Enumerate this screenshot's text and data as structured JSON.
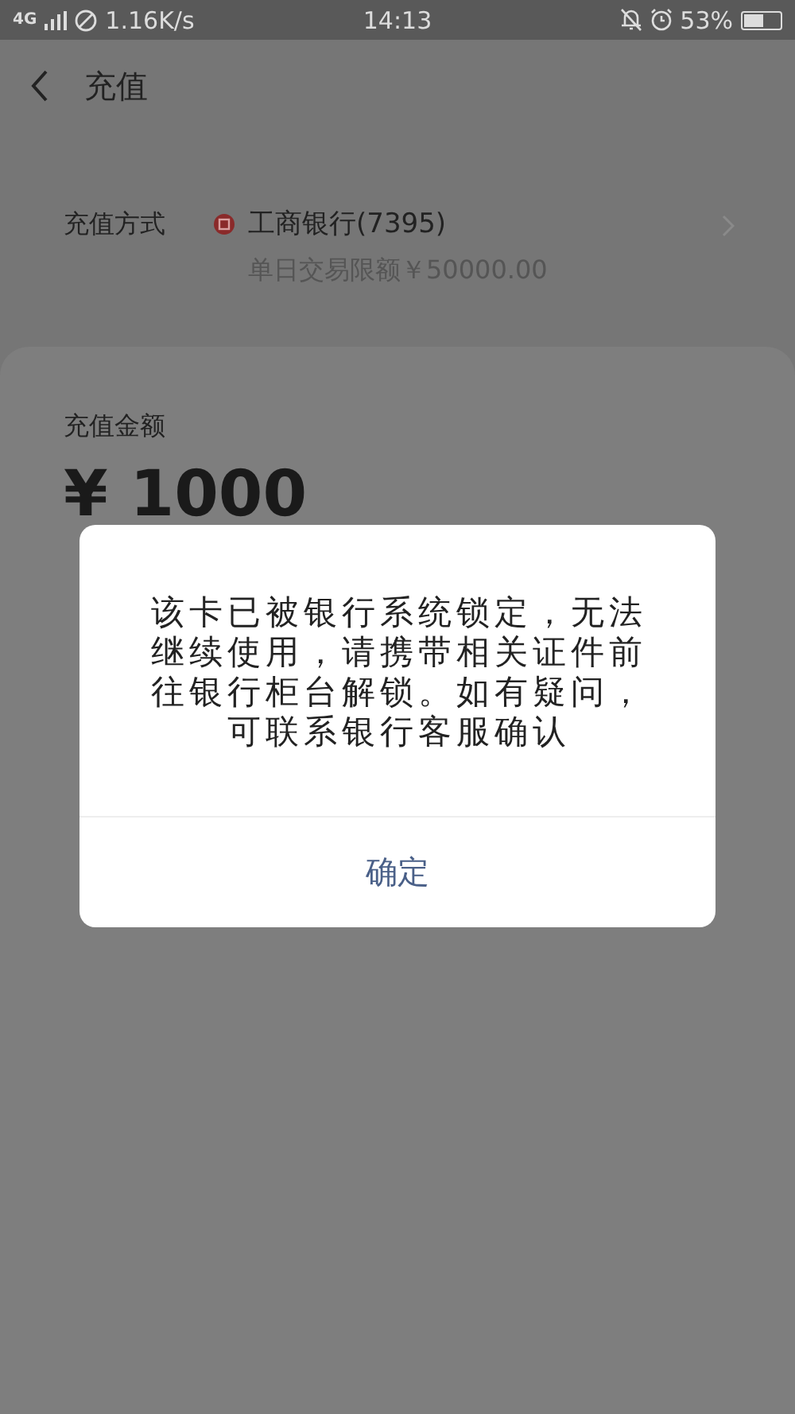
{
  "status_bar": {
    "network": "4G",
    "speed": "1.16K/s",
    "time": "14:13",
    "battery": "53%"
  },
  "header": {
    "title": "充值"
  },
  "payment": {
    "label": "充值方式",
    "bank": "工商银行(7395)",
    "limit": "单日交易限额￥50000.00"
  },
  "amount": {
    "label": "充值金额",
    "value": "¥ 1000"
  },
  "dialog": {
    "message": "该卡已被银行系统锁定，无法继续使用，请携带相关证件前往银行柜台解锁。如有疑问，可联系银行客服确认",
    "button": "确定"
  }
}
